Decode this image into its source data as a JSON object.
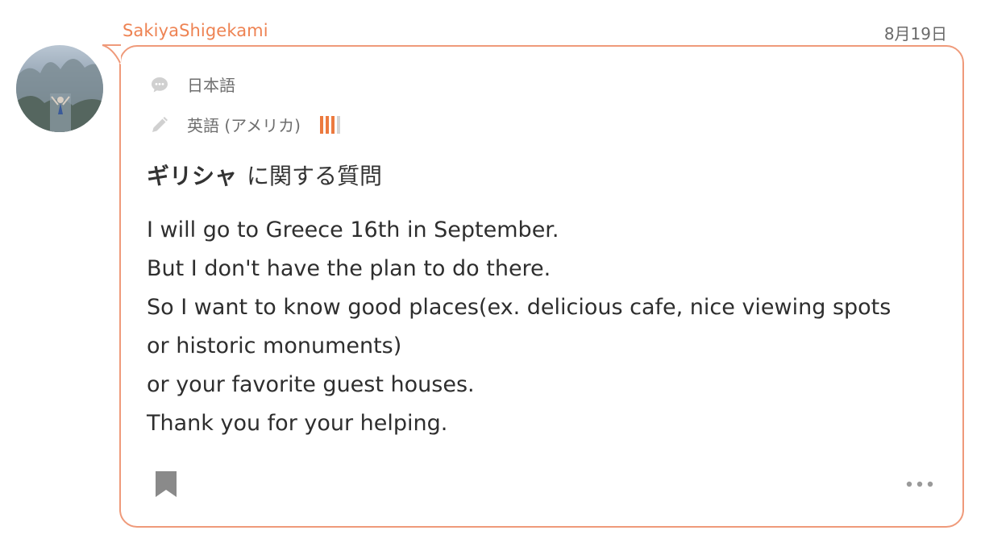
{
  "author": {
    "name": "SakiyaShigekami",
    "avatar_icon": "user-avatar-photo"
  },
  "post": {
    "date": "8月19日",
    "native_language": "日本語",
    "learning_language": "英語 (アメリカ)",
    "learning_level": 3,
    "learning_level_max": 4,
    "title_topic": "ギリシャ",
    "title_suffix": "に関する質問",
    "body_lines": [
      "I will go to Greece 16th in September.",
      "But I don't have the plan to do there.",
      "So I want to know good places(ex. delicious cafe, nice viewing spots",
      "or historic monuments)",
      "or your favorite guest houses.",
      "Thank you for your helping."
    ]
  },
  "icons": {
    "native_language": "speech-bubble-icon",
    "learning_language": "pencil-icon",
    "bookmark": "bookmark-icon",
    "more": "more-options-icon"
  },
  "colors": {
    "accent": "#ee8353",
    "card_border": "#ef9a7a",
    "level_on": "#ec7a3f",
    "level_off": "#d4d4d4"
  }
}
